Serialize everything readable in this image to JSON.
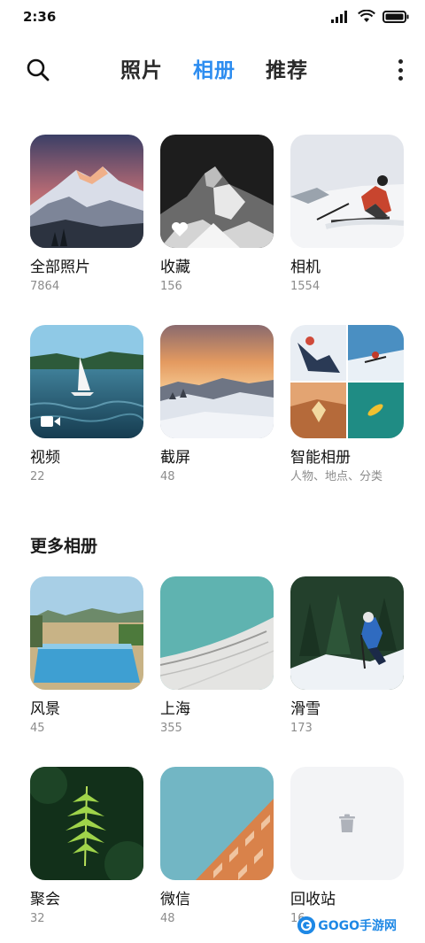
{
  "status": {
    "time": "2:36"
  },
  "tabs": [
    {
      "label": "照片",
      "active": false
    },
    {
      "label": "相册",
      "active": true
    },
    {
      "label": "推荐",
      "active": false
    }
  ],
  "albums": [
    {
      "name": "全部照片",
      "count": "7864",
      "icon": "mountain-photo"
    },
    {
      "name": "收藏",
      "count": "156",
      "icon": "heart-icon"
    },
    {
      "name": "相机",
      "count": "1554",
      "icon": "skier-photo"
    },
    {
      "name": "视频",
      "count": "22",
      "icon": "video-icon"
    },
    {
      "name": "截屏",
      "count": "48",
      "icon": "snow-landscape-photo"
    },
    {
      "name": "智能相册",
      "count": "人物、地点、分类",
      "icon": "collage-photo"
    }
  ],
  "more_section": {
    "title": "更多相册",
    "albums": [
      {
        "name": "风景",
        "count": "45",
        "icon": "pool-photo"
      },
      {
        "name": "上海",
        "count": "355",
        "icon": "building-photo"
      },
      {
        "name": "滑雪",
        "count": "173",
        "icon": "skier-forest-photo"
      },
      {
        "name": "聚会",
        "count": "32",
        "icon": "fern-photo"
      },
      {
        "name": "微信",
        "count": "48",
        "icon": "orange-building-photo"
      },
      {
        "name": "回收站",
        "count": "16",
        "icon": "trash-icon"
      }
    ]
  },
  "watermark": {
    "text": "GOGO手游网"
  },
  "colors": {
    "accent": "#2d8df0",
    "text": "#111111",
    "subtext": "#8c8c8c"
  }
}
